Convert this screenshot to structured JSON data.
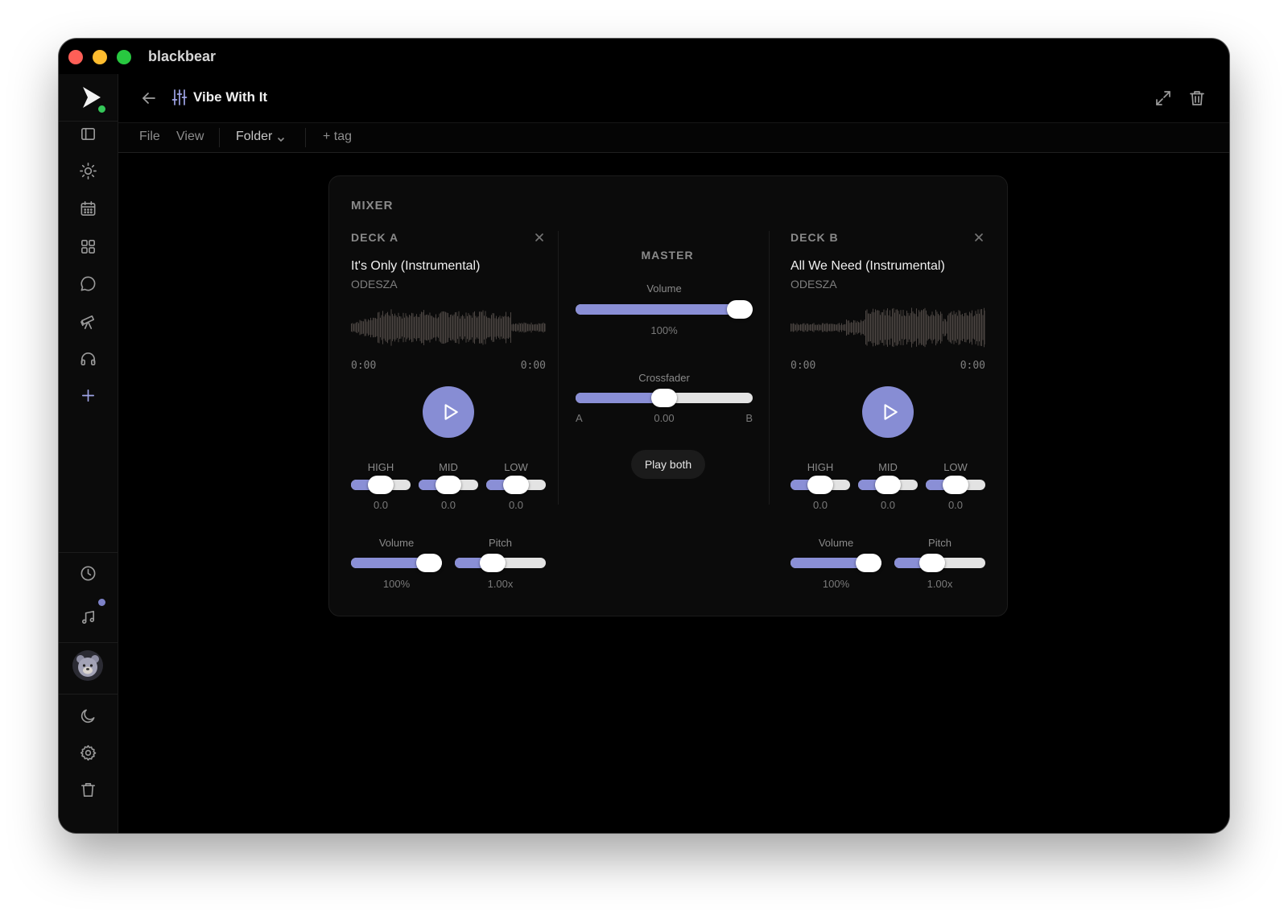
{
  "window": {
    "app_title": "blackbear"
  },
  "topbar": {
    "doc_title": "Vibe With It"
  },
  "menu": {
    "file": "File",
    "view": "View",
    "folder": "Folder",
    "tag": "+ tag"
  },
  "sidebar": {
    "items": [
      "panel-icon",
      "sun-icon",
      "calendar-icon",
      "grid-icon",
      "chat-icon",
      "telescope-icon",
      "headphones-icon",
      "plus-icon"
    ],
    "bottom": [
      "clock-icon",
      "music-note-icon",
      "avatar",
      "moon-icon",
      "gear-icon",
      "trash-icon"
    ]
  },
  "colors": {
    "accent": "#878dd4",
    "slider_fill": "#8a8fd6",
    "background": "#000000",
    "panel": "#0b0b0b"
  },
  "mixer": {
    "title": "MIXER",
    "deck_a": {
      "label": "DECK A",
      "title": "It's Only (Instrumental)",
      "artist": "ODESZA",
      "time_start": "0:00",
      "time_end": "0:00",
      "eq": [
        {
          "label": "HIGH",
          "value": "0.0",
          "level": 0.5
        },
        {
          "label": "MID",
          "value": "0.0",
          "level": 0.5
        },
        {
          "label": "LOW",
          "value": "0.0",
          "level": 0.5
        }
      ],
      "volume": {
        "label": "Volume",
        "value": "100%",
        "level": 1.0
      },
      "pitch": {
        "label": "Pitch",
        "value": "1.00x",
        "level": 0.38
      }
    },
    "master": {
      "title": "MASTER",
      "volume": {
        "label": "Volume",
        "value": "100%",
        "level": 1.0
      },
      "crossfader": {
        "label": "Crossfader",
        "value": "0.00",
        "a": "A",
        "b": "B",
        "level": 0.5
      },
      "play_both": "Play both"
    },
    "deck_b": {
      "label": "DECK B",
      "title": "All We Need (Instrumental)",
      "artist": "ODESZA",
      "time_start": "0:00",
      "time_end": "0:00",
      "eq": [
        {
          "label": "HIGH",
          "value": "0.0",
          "level": 0.5
        },
        {
          "label": "MID",
          "value": "0.0",
          "level": 0.5
        },
        {
          "label": "LOW",
          "value": "0.0",
          "level": 0.5
        }
      ],
      "volume": {
        "label": "Volume",
        "value": "100%",
        "level": 1.0
      },
      "pitch": {
        "label": "Pitch",
        "value": "1.00x",
        "level": 0.38
      }
    }
  }
}
